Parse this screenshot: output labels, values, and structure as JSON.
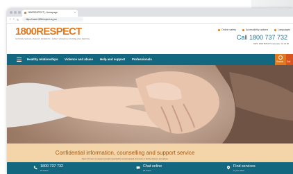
{
  "browser": {
    "tab_title": "1800RESPECT | Homepage",
    "tab_close": "×",
    "url": "https://www.1800respect.org.au",
    "back_glyph": "‹",
    "forward_glyph": "›",
    "reload_glyph": "↻"
  },
  "logo": {
    "number": "1800",
    "word": "RESPECT",
    "tagline": "NATIONAL SEXUAL ASSAULT, DOMESTIC · FAMILY VIOLENCE COUNSELLING SERVICE"
  },
  "header_links": [
    {
      "label": "Online safety"
    },
    {
      "label": "Accessibility options"
    },
    {
      "label": "Languages"
    }
  ],
  "phone": {
    "label": "Call 1800 737 732",
    "sub": "NRS: 1800 555 677    Interpreter: 13 14 50"
  },
  "nav": {
    "items": [
      {
        "label": "Healthy relationships"
      },
      {
        "label": "Violence and abuse"
      },
      {
        "label": "Help and support"
      },
      {
        "label": "Professionals"
      }
    ],
    "search_label": "Search",
    "exit_label": "Exit"
  },
  "band": {
    "title": "Confidential information, counselling and support service",
    "subtitle": "Open 24 hours to support people impacted by sexual assault, domestic or family violence and abuse"
  },
  "footer": {
    "items": [
      {
        "title": "1800 737 732",
        "sub": "24 hours"
      },
      {
        "title": "Chat online",
        "sub": "24 hours"
      },
      {
        "title": "Find services",
        "sub": "in your area"
      }
    ]
  },
  "colors": {
    "brand_orange": "#e07a1f",
    "nav_teal": "#13687f",
    "band_peach": "#f3d5a9"
  },
  "icons": [
    "lock-icon",
    "shield-icon",
    "accessibility-icon",
    "globe-icon",
    "search-icon",
    "phone-icon",
    "chat-icon",
    "location-icon",
    "menu-icon"
  ]
}
